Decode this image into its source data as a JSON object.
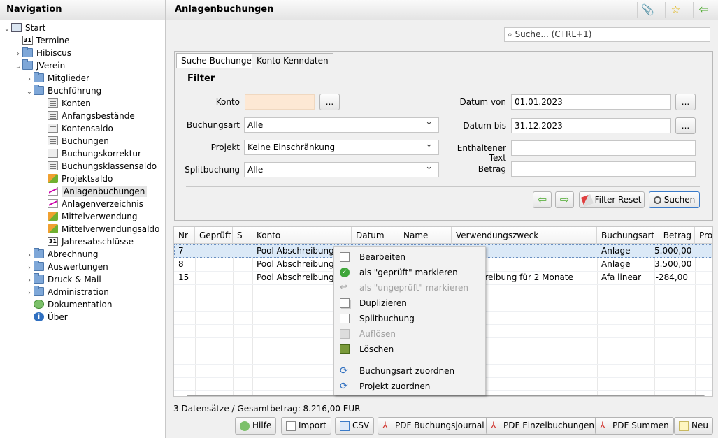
{
  "nav": {
    "title": "Navigation",
    "items": [
      {
        "label": "Start",
        "icon": "computer-icon"
      },
      {
        "label": "Termine",
        "icon": "calendar-icon"
      },
      {
        "label": "Hibiscus",
        "icon": "folder-icon"
      },
      {
        "label": "JVerein",
        "icon": "folder-icon"
      },
      {
        "label": "Mitglieder",
        "icon": "folder-icon"
      },
      {
        "label": "Buchführung",
        "icon": "folder-icon"
      },
      {
        "label": "Konten",
        "icon": "document-icon"
      },
      {
        "label": "Anfangsbestände",
        "icon": "document-icon"
      },
      {
        "label": "Kontensaldo",
        "icon": "document-icon"
      },
      {
        "label": "Buchungen",
        "icon": "document-icon"
      },
      {
        "label": "Buchungskorrektur",
        "icon": "document-icon"
      },
      {
        "label": "Buchungsklassensaldo",
        "icon": "document-icon"
      },
      {
        "label": "Projektsaldo",
        "icon": "project-icon"
      },
      {
        "label": "Anlagenbuchungen",
        "icon": "chart-icon"
      },
      {
        "label": "Anlagenverzeichnis",
        "icon": "chart-icon"
      },
      {
        "label": "Mittelverwendung",
        "icon": "transfer-icon"
      },
      {
        "label": "Mittelverwendungsaldo",
        "icon": "transfer-icon"
      },
      {
        "label": "Jahresabschlüsse",
        "icon": "calendar-icon"
      },
      {
        "label": "Abrechnung",
        "icon": "folder-icon"
      },
      {
        "label": "Auswertungen",
        "icon": "folder-icon"
      },
      {
        "label": "Druck & Mail",
        "icon": "folder-icon"
      },
      {
        "label": "Administration",
        "icon": "folder-icon"
      },
      {
        "label": "Dokumentation",
        "icon": "help-icon"
      },
      {
        "label": "Über",
        "icon": "info-icon"
      }
    ],
    "calendar_glyph": "31"
  },
  "header": {
    "title": "Anlagenbuchungen"
  },
  "search": {
    "placeholder": "Suche...    (CTRL+1)"
  },
  "tabs": [
    "Suche Buchungen",
    "Konto Kenndaten"
  ],
  "filter": {
    "title": "Filter",
    "konto_label": "Konto",
    "konto_value": "",
    "buchungsart_label": "Buchungsart",
    "buchungsart_value": "Alle",
    "projekt_label": "Projekt",
    "projekt_value": "Keine Einschränkung",
    "splitbuchung_label": "Splitbuchung",
    "splitbuchung_value": "Alle",
    "datum_von_label": "Datum von",
    "datum_von_value": "01.01.2023",
    "datum_bis_label": "Datum bis",
    "datum_bis_value": "31.12.2023",
    "text_label": "Enthaltener Text",
    "betrag_label": "Betrag",
    "dots": "...",
    "reset_label": "Filter-Reset",
    "suchen_label": "Suchen"
  },
  "table": {
    "columns": [
      "Nr",
      "Geprüft",
      "S",
      "Konto",
      "Datum",
      "Name",
      "Verwendungszweck",
      "Buchungsart",
      "Betrag",
      "Pro"
    ],
    "rows": [
      {
        "nr": "7",
        "konto": "Pool Abschreibung 2",
        "zweck": "",
        "art": "Anlage",
        "betrag": "5.000,00"
      },
      {
        "nr": "8",
        "konto": "Pool Abschreibung 2",
        "zweck": "",
        "art": "Anlage",
        "betrag": "3.500,00"
      },
      {
        "nr": "15",
        "konto": "Pool Abschreibung 2",
        "zweck": "e Abschreibung für 2 Monate",
        "art": "Afa linear",
        "betrag": "-284,00"
      }
    ]
  },
  "context_menu": {
    "items": [
      {
        "label": "Bearbeiten",
        "enabled": true
      },
      {
        "label": "als \"geprüft\" markieren",
        "enabled": true
      },
      {
        "label": "als \"ungeprüft\" markieren",
        "enabled": false
      },
      {
        "label": "Duplizieren",
        "enabled": true
      },
      {
        "label": "Splitbuchung",
        "enabled": true
      },
      {
        "label": "Auflösen",
        "enabled": false
      },
      {
        "label": "Löschen",
        "enabled": true
      },
      {
        "label": "Buchungsart zuordnen",
        "enabled": true
      },
      {
        "label": "Projekt zuordnen",
        "enabled": true
      }
    ]
  },
  "status": "3 Datensätze / Gesamtbetrag: 8.216,00 EUR",
  "buttons": {
    "hilfe": "Hilfe",
    "import": "Import",
    "csv": "CSV",
    "pdf_journal": "PDF Buchungsjournal",
    "pdf_einzel": "PDF Einzelbuchungen",
    "pdf_summen": "PDF Summen",
    "neu": "Neu"
  },
  "colors": {
    "konto_field": "#fde8d4",
    "selection": "#dbe9f7",
    "green_arrow": "#4aa82c"
  }
}
